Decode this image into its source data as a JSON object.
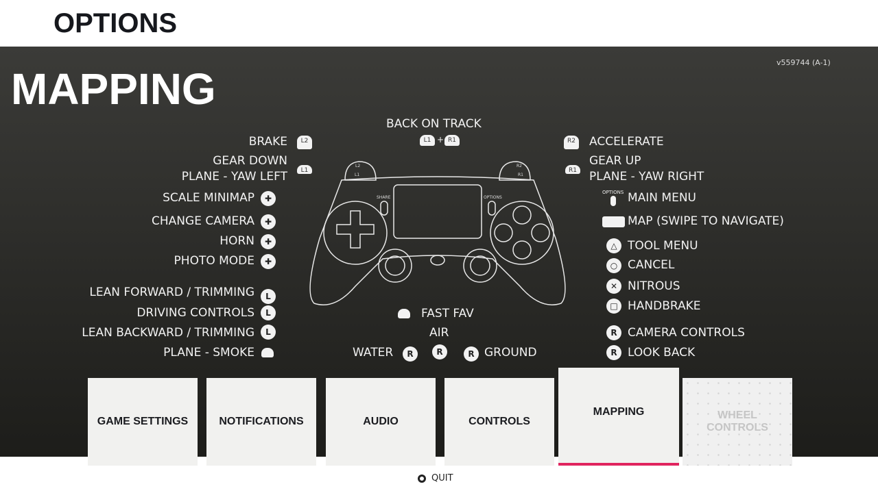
{
  "header": {
    "title": "OPTIONS"
  },
  "page": {
    "title": "MAPPING",
    "version": "v559744 (A-1)"
  },
  "top": {
    "label": "BACK ON TRACK",
    "combo": [
      "L1",
      "+",
      "R1"
    ]
  },
  "left": [
    {
      "label": "BRAKE",
      "icon": "L2"
    },
    {
      "label": "GEAR DOWN",
      "icon": "L1"
    },
    {
      "label": "PLANE - YAW LEFT"
    },
    {
      "label": "SCALE MINIMAP",
      "icon": "dpad-up"
    },
    {
      "label": "CHANGE CAMERA",
      "icon": "dpad-right"
    },
    {
      "label": "HORN",
      "icon": "dpad-down"
    },
    {
      "label": "PHOTO MODE",
      "icon": "dpad-left"
    },
    {
      "label": "LEAN FORWARD / TRIMMING",
      "icon": "L"
    },
    {
      "label": "DRIVING CONTROLS",
      "icon": "L"
    },
    {
      "label": "LEAN BACKWARD / TRIMMING",
      "icon": "L"
    },
    {
      "label": "PLANE - SMOKE",
      "icon": "L3"
    }
  ],
  "right": [
    {
      "label": "ACCELERATE",
      "icon": "R2"
    },
    {
      "label": "GEAR UP",
      "icon": "R1"
    },
    {
      "label": "PLANE - YAW RIGHT"
    },
    {
      "label": "MAIN MENU",
      "icon": "OPTIONS"
    },
    {
      "label": "MAP (SWIPE TO NAVIGATE)",
      "icon": "touchpad"
    },
    {
      "label": "TOOL MENU",
      "icon": "triangle"
    },
    {
      "label": "CANCEL",
      "icon": "circle"
    },
    {
      "label": "NITROUS",
      "icon": "cross"
    },
    {
      "label": "HANDBRAKE",
      "icon": "square"
    },
    {
      "label": "CAMERA CONTROLS",
      "icon": "R"
    },
    {
      "label": "LOOK BACK",
      "icon": "R"
    }
  ],
  "center": {
    "fast_fav": "FAST FAV",
    "air": "AIR",
    "water": "WATER",
    "ground": "GROUND",
    "r": "R"
  },
  "controller": {
    "l2": "L2",
    "l1": "L1",
    "r2": "R2",
    "r1": "R1",
    "share": "SHARE",
    "options": "OPTIONS"
  },
  "tabs": [
    {
      "label": "GAME SETTINGS",
      "state": "normal"
    },
    {
      "label": "NOTIFICATIONS",
      "state": "normal"
    },
    {
      "label": "AUDIO",
      "state": "normal"
    },
    {
      "label": "CONTROLS",
      "state": "normal"
    },
    {
      "label": "MAPPING",
      "state": "active"
    },
    {
      "label": "WHEEL CONTROLS",
      "state": "disabled"
    }
  ],
  "footer": {
    "quit": "QUIT"
  },
  "colors": {
    "accent": "#e0245e",
    "panel": "#2c2c2a"
  }
}
